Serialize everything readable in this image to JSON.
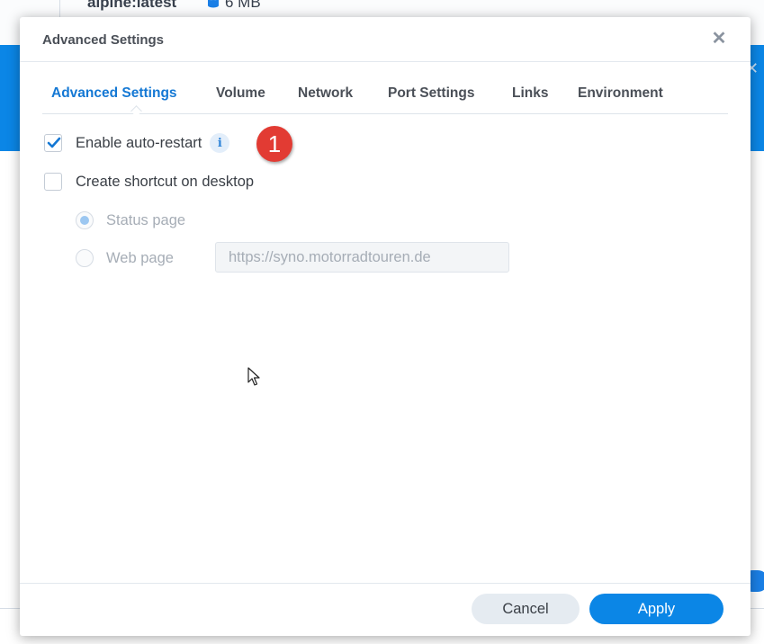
{
  "background": {
    "image_name": "alpine:latest",
    "image_size": "6 MB",
    "icons": {
      "db": "database-icon"
    }
  },
  "dialog": {
    "title": "Advanced Settings",
    "close_icon": "close-icon",
    "tabs": [
      {
        "label": "Advanced Settings",
        "active": true
      },
      {
        "label": "Volume",
        "active": false
      },
      {
        "label": "Network",
        "active": false
      },
      {
        "label": "Port Settings",
        "active": false
      },
      {
        "label": "Links",
        "active": false
      },
      {
        "label": "Environment",
        "active": false
      }
    ],
    "options": {
      "auto_restart": {
        "label": "Enable auto-restart",
        "checked": true,
        "info_icon": "info-icon",
        "info_glyph": "i"
      },
      "desktop_shortcut": {
        "label": "Create shortcut on desktop",
        "checked": false
      },
      "shortcut_targets": {
        "status_page": {
          "label": "Status page",
          "selected": true,
          "disabled": true
        },
        "web_page": {
          "label": "Web page",
          "selected": false,
          "disabled": true
        },
        "url_value": "https://syno.motorradtouren.de"
      }
    },
    "annotation_badge": "1",
    "buttons": {
      "cancel": "Cancel",
      "apply": "Apply"
    }
  },
  "colors": {
    "accent": "#0b86e6",
    "active_tab": "#1478d4",
    "badge": "#e23b33"
  }
}
